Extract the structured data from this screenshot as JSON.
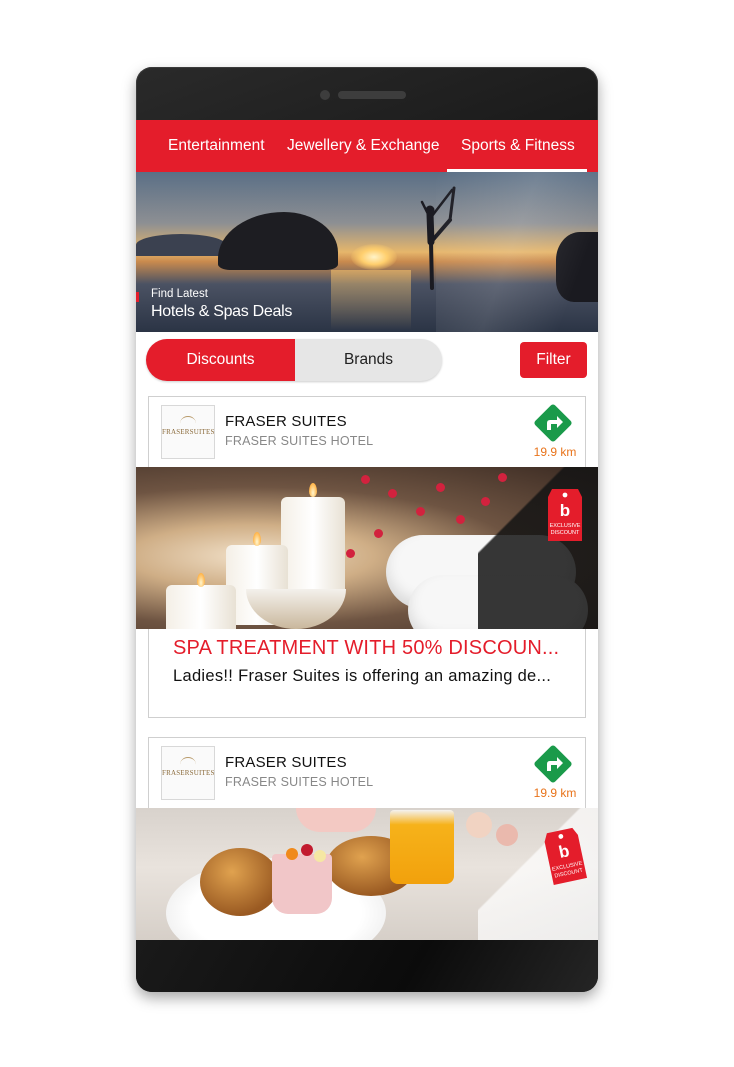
{
  "categories": {
    "tabs": [
      {
        "label": "Entertainment"
      },
      {
        "label": "Jewellery & Exchange"
      },
      {
        "label": "Sports & Fitness",
        "active": true
      }
    ]
  },
  "banner": {
    "caption_small": "Find Latest",
    "caption_big": "Hotels & Spas Deals"
  },
  "segment": {
    "discounts_label": "Discounts",
    "brands_label": "Brands",
    "selected": "Discounts"
  },
  "filter_label": "Filter",
  "deals": [
    {
      "brand_logo_text": "FRASERSUITES",
      "brand": "FRASER SUITES",
      "hotel": "FRASER SUITES HOTEL",
      "distance": "19.9 km",
      "image": "spa-candles-towels",
      "tag": "EXCLUSIVE DISCOUNT",
      "title": "SPA TREATMENT WITH 50% DISCOUN...",
      "description": "Ladies!! Fraser Suites is offering an amazing de..."
    },
    {
      "brand_logo_text": "FRASERSUITES",
      "brand": "FRASER SUITES",
      "hotel": "FRASER SUITES HOTEL",
      "distance": "19.9 km",
      "image": "breakfast-croissants",
      "tag": "EXCLUSIVE DISCOUNT"
    }
  ],
  "colors": {
    "accent": "#e41d2b",
    "direction_icon": "#1a9a4a",
    "distance": "#e8731a"
  },
  "icons": {
    "direction": "turn-right-arrow-icon",
    "tag": "exclusive-discount-tag-icon"
  }
}
